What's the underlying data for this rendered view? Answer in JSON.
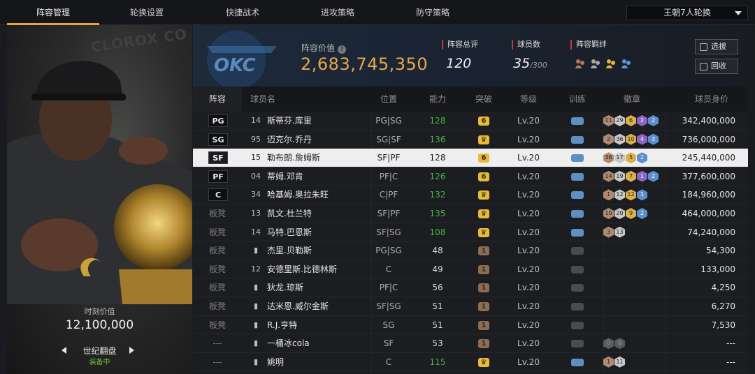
{
  "nav": {
    "tabs": [
      "阵容管理",
      "轮换设置",
      "快捷战术",
      "进攻策略",
      "防守策略"
    ],
    "active_tab": 0,
    "rotation_select": "王朝7人轮换"
  },
  "left_panel": {
    "background_text": "CLOROX CO",
    "value_label": "时刻价值",
    "value": "12,100,000",
    "card_name": "世纪翻盘",
    "equip_status": "装备中"
  },
  "summary": {
    "team": "OKC",
    "value_label": "阵容价值",
    "value": "2,683,745,350",
    "rating_label": "阵容总评",
    "rating": "120",
    "players_label": "球员数",
    "players": "35",
    "players_max": "/300",
    "bond_label": "阵容羁绊",
    "bond_icons": [
      "bond-bronze-icon",
      "bond-silver-icon",
      "bond-gold-icon",
      "bond-blue-icon"
    ],
    "buttons": {
      "pick": "选拔",
      "recycle": "回收"
    }
  },
  "table": {
    "headers": [
      "阵容",
      "球员名",
      "位置",
      "能力",
      "突破",
      "等级",
      "训练",
      "徽章",
      "球员身价"
    ],
    "rows": [
      {
        "slot": "PG",
        "starter": true,
        "number": "14",
        "name": "斯蒂芬.库里",
        "pos": "PG|SG",
        "ability": "128",
        "ability_green": true,
        "breakthrough": "6",
        "bt_type": "gold",
        "level": "Lv.20",
        "train": true,
        "badges": [
          [
            "b",
            "11"
          ],
          [
            "s",
            "29"
          ],
          [
            "g",
            "6"
          ],
          [
            "p",
            "2"
          ],
          [
            "u",
            "2"
          ]
        ],
        "salary": "342,400,000"
      },
      {
        "slot": "SG",
        "starter": true,
        "number": "95",
        "name": "迈克尔.乔丹",
        "pos": "SG|SF",
        "ability": "136",
        "ability_green": true,
        "breakthrough": "♛",
        "bt_type": "gold",
        "level": "Lv.20",
        "train": true,
        "badges": [
          [
            "b",
            "2"
          ],
          [
            "s",
            "36"
          ],
          [
            "g",
            "10"
          ],
          [
            "p",
            "4"
          ],
          [
            "u",
            "3"
          ]
        ],
        "salary": "736,000,000"
      },
      {
        "slot": "SF",
        "starter": true,
        "selected": true,
        "number": "15",
        "name": "勒布朗.詹姆斯",
        "pos": "SF|PF",
        "ability": "128",
        "ability_green": false,
        "breakthrough": "6",
        "bt_type": "gold",
        "level": "Lv.20",
        "train": true,
        "badges": [
          [
            "b",
            "36"
          ],
          [
            "s",
            "17"
          ],
          [
            "g",
            "5"
          ],
          [
            "u",
            "2"
          ]
        ],
        "salary": "245,440,000"
      },
      {
        "slot": "PF",
        "starter": true,
        "number": "04",
        "name": "蒂姆.邓肯",
        "pos": "PF|C",
        "ability": "126",
        "ability_green": true,
        "breakthrough": "6",
        "bt_type": "gold",
        "level": "Lv.20",
        "train": true,
        "badges": [
          [
            "b",
            "14"
          ],
          [
            "s",
            "19"
          ],
          [
            "g",
            "7"
          ],
          [
            "p",
            "1"
          ],
          [
            "u",
            "2"
          ]
        ],
        "salary": "377,600,000"
      },
      {
        "slot": "C",
        "starter": true,
        "number": "34",
        "name": "哈基姆.奥拉朱旺",
        "pos": "C|PF",
        "ability": "132",
        "ability_green": true,
        "breakthrough": "♛",
        "bt_type": "gold",
        "level": "Lv.20",
        "train": true,
        "badges": [
          [
            "b",
            "1"
          ],
          [
            "s",
            "12"
          ],
          [
            "g",
            "12"
          ],
          [
            "u",
            "1"
          ]
        ],
        "salary": "184,960,000"
      },
      {
        "slot": "板凳",
        "starter": false,
        "number": "13",
        "name": "凯文.杜兰特",
        "pos": "SF|PF",
        "ability": "135",
        "ability_green": true,
        "breakthrough": "♛",
        "bt_type": "gold",
        "level": "Lv.20",
        "train": true,
        "badges": [
          [
            "b",
            "10"
          ],
          [
            "s",
            "20"
          ],
          [
            "g",
            "9"
          ],
          [
            "u",
            "2"
          ]
        ],
        "salary": "464,000,000"
      },
      {
        "slot": "板凳",
        "starter": false,
        "number": "14",
        "name": "马特.巴恩斯",
        "pos": "SF|SG",
        "ability": "108",
        "ability_green": true,
        "breakthrough": "♛",
        "bt_type": "gold",
        "level": "Lv.20",
        "train": true,
        "badges": [
          [
            "b",
            "3"
          ],
          [
            "s",
            "13"
          ]
        ],
        "salary": "74,240,000"
      },
      {
        "slot": "板凳",
        "starter": false,
        "number": "",
        "name": "杰里.贝勒斯",
        "pos": "PG|SG",
        "ability": "48",
        "ability_green": false,
        "breakthrough": "1",
        "bt_type": "brown",
        "level": "Lv.20",
        "train": false,
        "badges": [],
        "salary": "54,300"
      },
      {
        "slot": "板凳",
        "starter": false,
        "number": "12",
        "name": "安德里斯.比德林斯",
        "pos": "C",
        "ability": "49",
        "ability_green": false,
        "breakthrough": "1",
        "bt_type": "brown",
        "level": "Lv.20",
        "train": false,
        "badges": [],
        "salary": "133,000"
      },
      {
        "slot": "板凳",
        "starter": false,
        "number": "",
        "name": "狄龙.琼斯",
        "pos": "PF|C",
        "ability": "56",
        "ability_green": false,
        "breakthrough": "1",
        "bt_type": "brown",
        "level": "Lv.20",
        "train": false,
        "badges": [],
        "salary": "4,250"
      },
      {
        "slot": "板凳",
        "starter": false,
        "number": "",
        "name": "达米恩.威尔金斯",
        "pos": "SF|SG",
        "ability": "51",
        "ability_green": false,
        "breakthrough": "1",
        "bt_type": "brown",
        "level": "Lv.20",
        "train": false,
        "badges": [],
        "salary": "6,270"
      },
      {
        "slot": "板凳",
        "starter": false,
        "number": "",
        "name": "R.J.亨特",
        "pos": "SG",
        "ability": "51",
        "ability_green": false,
        "breakthrough": "1",
        "bt_type": "brown",
        "level": "Lv.20",
        "train": false,
        "badges": [],
        "salary": "7,530"
      },
      {
        "slot": "---",
        "starter": false,
        "number": "",
        "name": "一桶冰cola",
        "pos": "SF",
        "ability": "53",
        "ability_green": false,
        "breakthrough": "1",
        "bt_type": "brown",
        "level": "Lv.20",
        "train": false,
        "badges": [
          [
            "d",
            "0"
          ],
          [
            "d",
            "0"
          ]
        ],
        "salary": "---"
      },
      {
        "slot": "---",
        "starter": false,
        "number": "",
        "name": "姚明",
        "pos": "C",
        "ability": "115",
        "ability_green": true,
        "breakthrough": "♛",
        "bt_type": "gold",
        "level": "Lv.20",
        "train": true,
        "badges": [
          [
            "b",
            "1"
          ],
          [
            "s",
            "11"
          ]
        ],
        "salary": "---"
      }
    ]
  },
  "colors": {
    "accent": "#e8a43a",
    "value": "#e6a84a",
    "ability_green": "#46b241",
    "train_blue": "#5d8fc2"
  }
}
